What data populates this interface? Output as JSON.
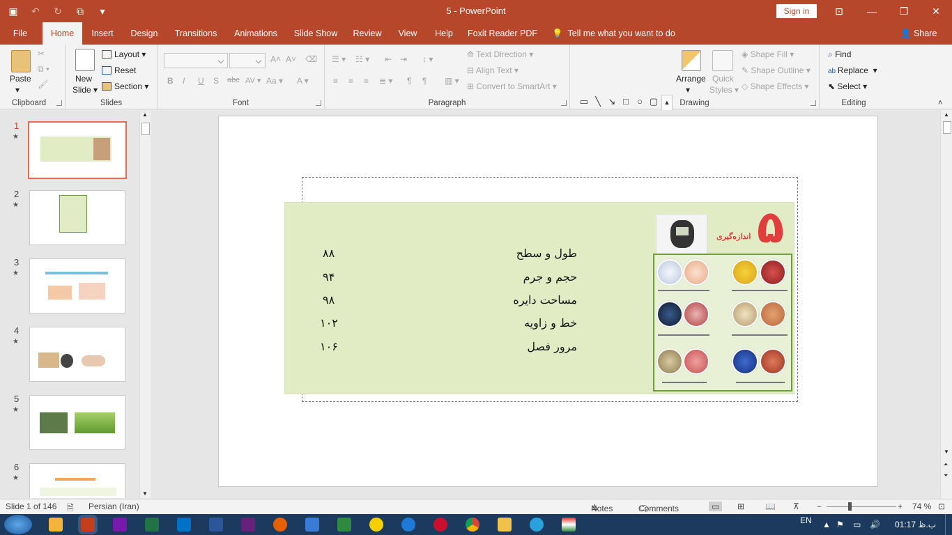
{
  "window": {
    "title": "5  -  PowerPoint",
    "sign_in": "Sign in"
  },
  "tabs": [
    "File",
    "Home",
    "Insert",
    "Design",
    "Transitions",
    "Animations",
    "Slide Show",
    "Review",
    "View",
    "Help",
    "Foxit Reader PDF"
  ],
  "tell_me": "Tell me what you want to do",
  "share": "Share",
  "ribbon": {
    "clipboard": {
      "label": "Clipboard",
      "paste": "Paste"
    },
    "slides": {
      "label": "Slides",
      "new_slide_1": "New",
      "new_slide_2": "Slide",
      "layout": "Layout",
      "reset": "Reset",
      "section": "Section"
    },
    "font": {
      "label": "Font"
    },
    "paragraph": {
      "label": "Paragraph",
      "text_direction": "Text Direction",
      "align_text": "Align Text",
      "convert_smartart": "Convert to SmartArt"
    },
    "drawing": {
      "label": "Drawing",
      "arrange": "Arrange",
      "quick_styles_1": "Quick",
      "quick_styles_2": "Styles",
      "shape_fill": "Shape Fill",
      "shape_outline": "Shape Outline",
      "shape_effects": "Shape Effects"
    },
    "editing": {
      "label": "Editing",
      "find": "Find",
      "replace": "Replace",
      "select": "Select"
    }
  },
  "thumbnails": [
    {
      "num": "1"
    },
    {
      "num": "2"
    },
    {
      "num": "3"
    },
    {
      "num": "4"
    },
    {
      "num": "5"
    },
    {
      "num": "6"
    }
  ],
  "slide": {
    "book_number": "۵",
    "book_title": "اندازه‌گیری",
    "toc": [
      {
        "title": "طول و سطح",
        "page": "۸۸"
      },
      {
        "title": "حجم و جرم",
        "page": "۹۴"
      },
      {
        "title": "مساحت دایره",
        "page": "۹۸"
      },
      {
        "title": "خط و زاویه",
        "page": "۱۰۲"
      },
      {
        "title": "مرور فصل",
        "page": "۱۰۶"
      }
    ]
  },
  "status": {
    "slide_count": "Slide 1 of 146",
    "language": "Persian (Iran)",
    "notes": "Notes",
    "comments": "Comments",
    "zoom": "74 %"
  },
  "taskbar": {
    "lang": "EN",
    "time": "01:17 ب.ظ"
  },
  "colors": {
    "accent": "#b7472a",
    "selection": "#e9694d",
    "picture_bg": "#e1ecc5"
  }
}
